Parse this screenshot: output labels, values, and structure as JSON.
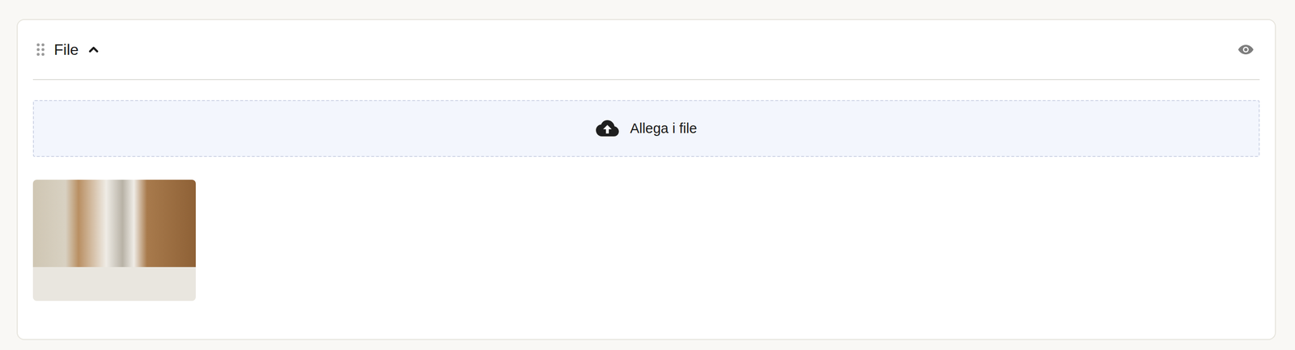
{
  "section": {
    "title": "File",
    "expanded": true,
    "visible": true
  },
  "dropzone": {
    "label": "Allega i file"
  },
  "files": [
    {
      "kind": "image"
    }
  ]
}
